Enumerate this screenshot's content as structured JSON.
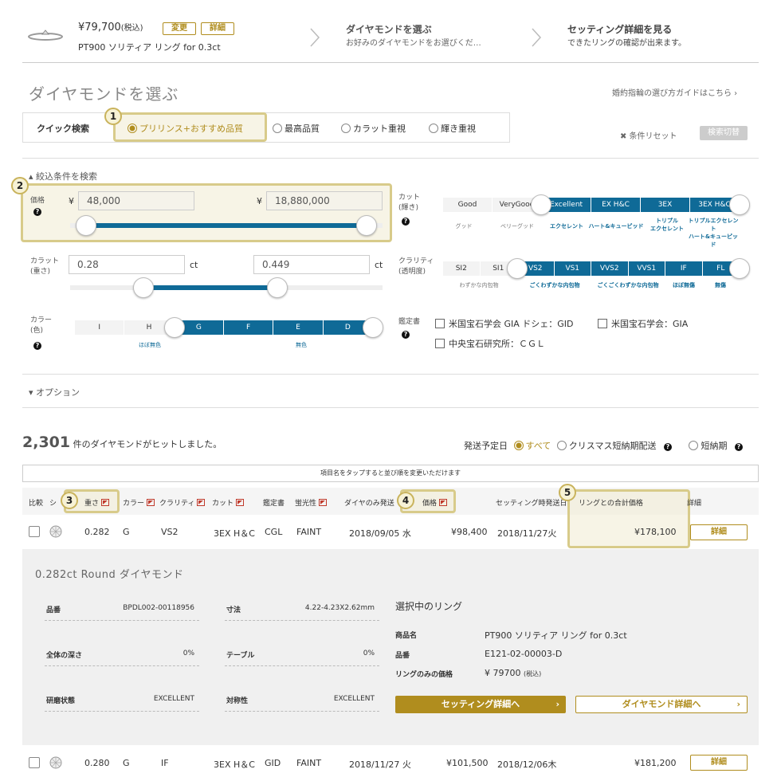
{
  "steps": {
    "ring_price": "¥79,700",
    "ring_price_tax": "(税込)",
    "change_btn": "変更",
    "detail_btn": "詳細",
    "ring_name": "PT900 ソリティア リング for 0.3ct",
    "step2_title": "ダイヤモンドを選ぶ",
    "step2_sub": "お好みのダイヤモンドをお選びくだ…",
    "step3_title": "セッティング詳細を見る",
    "step3_sub": "できたリングの確認が出来ます。"
  },
  "page": {
    "title": "ダイヤモンドを選ぶ",
    "guide_link": "婚約指輪の選び方ガイドはこちら ›"
  },
  "quick": {
    "label": "クイック検索",
    "options": [
      "プリリンス+おすすめ品質",
      "最高品質",
      "カラット重視",
      "輝き重視"
    ],
    "reset": "✖ 条件リセット",
    "toggle": "検索切替"
  },
  "filters": {
    "title": "絞込条件を検索",
    "price_label": "価格",
    "price_min": "48,000",
    "price_max": "18,880,000",
    "yen": "¥",
    "price_min_fraction": 0.0,
    "price_max_fraction": 1.0,
    "carat_label1": "カラット",
    "carat_label2": "(重さ)",
    "carat_min": "0.28",
    "carat_max": "0.449",
    "ct": "ct",
    "color_label1": "カラー",
    "color_label2": "(色)",
    "color_grades": [
      "I",
      "H",
      "G",
      "F",
      "E",
      "D"
    ],
    "color_sub": [
      "ほぼ無色",
      "無色"
    ],
    "cut_label1": "カット",
    "cut_label2": "(輝き)",
    "cut_grades": [
      "Good",
      "VeryGood",
      "Excellent",
      "EX H&C",
      "3EX",
      "3EX H&C"
    ],
    "cut_sub": [
      "グッド",
      "ベリーグッド",
      "エクセレント",
      "ハート&キューピッド",
      "トリプル",
      "エクセレント",
      "トリプルエクセレント",
      "ハート&キューピッド"
    ],
    "clarity_label1": "クラリティ",
    "clarity_label2": "(透明度)",
    "clarity_grades": [
      "SI2",
      "SI1",
      "VS2",
      "VS1",
      "VVS2",
      "VVS1",
      "IF",
      "FL"
    ],
    "clarity_sub": [
      "わずかな内包物",
      "ごくわずかな内包物",
      "ごくごくわずかな内包物",
      "ほぼ無傷",
      "無傷"
    ],
    "cert_label": "鑑定書",
    "certs": [
      "米国宝石学会 GIA ドシェ：GID",
      "米国宝石学会：GIA",
      "中央宝石研究所：ＣＧＬ"
    ],
    "option_label": "オプション"
  },
  "results": {
    "count": "2,301",
    "count_suffix": "件のダイヤモンドがヒットしました。",
    "ship_label": "発送予定日",
    "ship_options": [
      "すべて",
      "クリスマス短納期配送",
      "短納期"
    ],
    "sort_hint": "項目名をタップすると並び順を変更いただけます"
  },
  "table": {
    "headers": [
      "比較",
      "シ",
      "重さ",
      "カラー",
      "クラリティ",
      "カット",
      "鑑定書",
      "蛍光性",
      "ダイヤのみ発送",
      "価格",
      "セッティング時発送日",
      "リングとの合計価格",
      "詳細"
    ],
    "rows": [
      [
        "0.282",
        "G",
        "VS2",
        "3EX H＆C",
        "CGL",
        "FAINT",
        "2018/09/05 水",
        "¥98,400",
        "2018/11/27火",
        "¥178,100",
        "詳細"
      ],
      [
        "0.280",
        "G",
        "IF",
        "3EX H＆C",
        "GID",
        "FAINT",
        "2018/11/27 火",
        "¥101,500",
        "2018/12/06木",
        "¥181,200",
        "詳細"
      ]
    ]
  },
  "detail": {
    "title": "0.282ct Round ダイヤモンド",
    "specs": [
      {
        "k": "品番",
        "v": "BPDL002-00118956"
      },
      {
        "k": "寸法",
        "v": "4.22-4.23X2.62mm"
      },
      {
        "k": "全体の深さ",
        "v": "0%"
      },
      {
        "k": "テーブル",
        "v": "0%"
      },
      {
        "k": "研磨状態",
        "v": "EXCELLENT"
      },
      {
        "k": "対称性",
        "v": "EXCELLENT"
      }
    ],
    "ring_title": "選択中のリング",
    "ring_rows": [
      {
        "k": "商品名",
        "v": "PT900 ソリティア リング for 0.3ct"
      },
      {
        "k": "品番",
        "v": "E121-02-00003-D"
      },
      {
        "k": "リングのみの価格",
        "v": "¥ 79700",
        "tax": "(税込)"
      }
    ],
    "btn_setting": "セッティング詳細へ",
    "btn_diamond": "ダイヤモンド詳細へ"
  },
  "badges": [
    "1",
    "2",
    "3",
    "4",
    "5"
  ],
  "colors": {
    "accent": "#b08d1e",
    "selected": "#0f6a97"
  }
}
